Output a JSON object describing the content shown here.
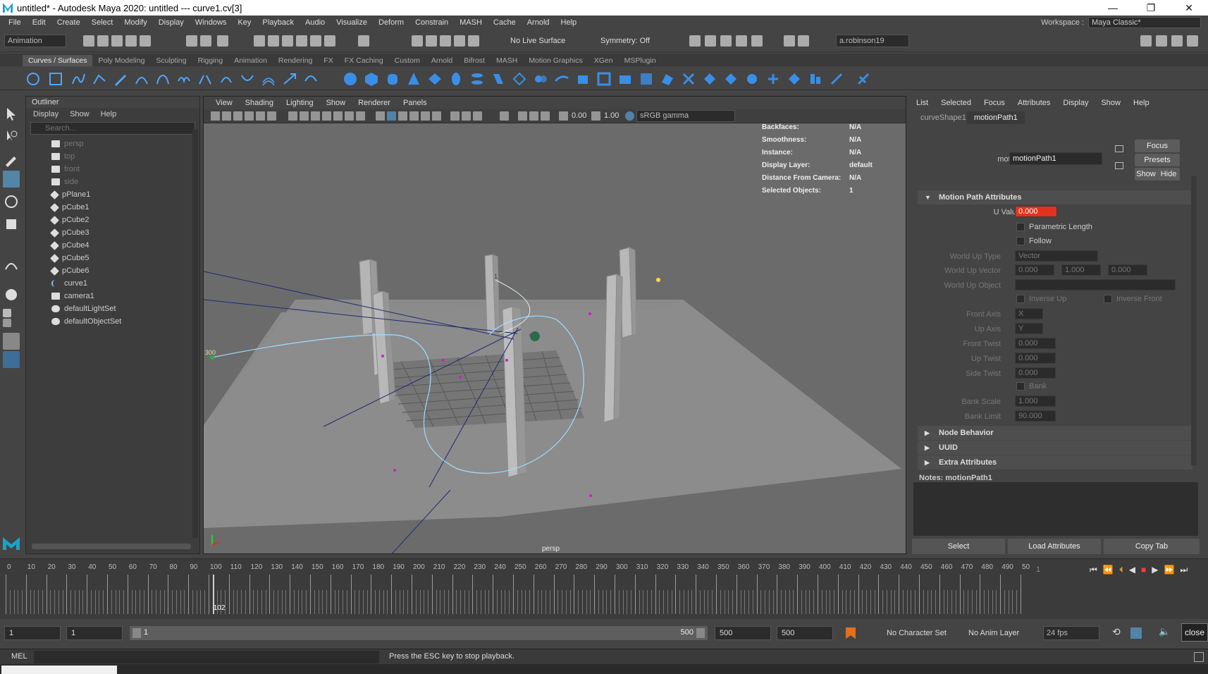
{
  "window": {
    "title": "untitled* - Autodesk Maya 2020: untitled   ---   curve1.cv[3]",
    "min": "—",
    "max": "❐",
    "close": "✕"
  },
  "menus": [
    "File",
    "Edit",
    "Create",
    "Select",
    "Modify",
    "Display",
    "Windows",
    "Key",
    "Playback",
    "Audio",
    "Visualize",
    "Deform",
    "Constrain",
    "MASH",
    "Cache",
    "Arnold",
    "Help"
  ],
  "workspace": {
    "label": "Workspace :",
    "value": "Maya Classic*"
  },
  "statusline": {
    "menuset": "Animation",
    "live_surface": "No Live Surface",
    "symmetry": "Symmetry: Off",
    "user": "a.robinson19"
  },
  "shelf_tabs": [
    "Curves / Surfaces",
    "Poly Modeling",
    "Sculpting",
    "Rigging",
    "Animation",
    "Rendering",
    "FX",
    "FX Caching",
    "Custom",
    "Arnold",
    "Bifrost",
    "MASH",
    "Motion Graphics",
    "XGen",
    "MSPlugin"
  ],
  "outliner": {
    "title": "Outliner",
    "menu": [
      "Display",
      "Show",
      "Help"
    ],
    "search_placeholder": "Search...",
    "items": [
      "persp",
      "top",
      "front",
      "side",
      "pPlane1",
      "pCube1",
      "pCube2",
      "pCube3",
      "pCube4",
      "pCube5",
      "pCube6",
      "curve1",
      "camera1",
      "defaultLightSet",
      "defaultObjectSet"
    ]
  },
  "viewport": {
    "menu": [
      "View",
      "Shading",
      "Lighting",
      "Show",
      "Renderer",
      "Panels"
    ],
    "exposure": "0.00",
    "gamma": "1.00",
    "colorspace": "sRGB gamma",
    "camera_label": "persp",
    "frame_marker": "300",
    "hud": [
      {
        "k": "Backfaces:",
        "v": "N/A"
      },
      {
        "k": "Smoothness:",
        "v": "N/A"
      },
      {
        "k": "Instance:",
        "v": "N/A"
      },
      {
        "k": "Display Layer:",
        "v": "default"
      },
      {
        "k": "Distance From Camera:",
        "v": "N/A"
      },
      {
        "k": "Selected Objects:",
        "v": "1"
      }
    ]
  },
  "attr": {
    "menu": [
      "List",
      "Selected",
      "Focus",
      "Attributes",
      "Display",
      "Show",
      "Help"
    ],
    "tabs": [
      "curveShape1",
      "motionPath1"
    ],
    "node_label": "motionPath:",
    "node_value": "motionPath1",
    "focus": "Focus",
    "presets": "Presets",
    "show": "Show",
    "hide": "Hide",
    "section": "Motion Path Attributes",
    "u_value_label": "U Value",
    "u_value": "0.000",
    "parametric_length": "Parametric Length",
    "follow": "Follow",
    "world_up_type_label": "World Up Type",
    "world_up_type": "Vector",
    "world_up_vector_label": "World Up Vector",
    "wuv": [
      "0.000",
      "1.000",
      "0.000"
    ],
    "world_up_object_label": "World Up Object",
    "inverse_up": "Inverse Up",
    "inverse_front": "Inverse Front",
    "front_axis_label": "Front Axis",
    "front_axis": "X",
    "up_axis_label": "Up Axis",
    "up_axis": "Y",
    "front_twist_label": "Front Twist",
    "front_twist": "0.000",
    "up_twist_label": "Up Twist",
    "up_twist": "0.000",
    "side_twist_label": "Side Twist",
    "side_twist": "0.000",
    "bank": "Bank",
    "bank_scale_label": "Bank Scale",
    "bank_scale": "1.000",
    "bank_limit_label": "Bank Limit",
    "bank_limit": "90.000",
    "collapsed": [
      "Node Behavior",
      "UUID",
      "Extra Attributes"
    ],
    "notes": "Notes:  motionPath1",
    "select": "Select",
    "load": "Load Attributes",
    "copy": "Copy Tab"
  },
  "timeline": {
    "ticks": [
      "0",
      "10",
      "20",
      "30",
      "40",
      "50",
      "60",
      "70",
      "80",
      "90",
      "100",
      "110",
      "120",
      "130",
      "140",
      "150",
      "160",
      "170",
      "180",
      "190",
      "200",
      "210",
      "220",
      "230",
      "240",
      "250",
      "260",
      "270",
      "280",
      "290",
      "300",
      "310",
      "320",
      "330",
      "340",
      "350",
      "360",
      "370",
      "380",
      "390",
      "400",
      "410",
      "420",
      "430",
      "440",
      "450",
      "460",
      "470",
      "480",
      "490",
      "50"
    ],
    "current": "102",
    "current_frame_field": "1"
  },
  "range": {
    "start": "1",
    "playstart": "1",
    "slider_start": "1",
    "slider_end": "500",
    "playend": "500",
    "end": "500",
    "char_set": "No Character Set",
    "anim_layer": "No Anim Layer",
    "fps": "24 fps",
    "close_tooltip": "close"
  },
  "cmdline": {
    "label": "MEL",
    "help": "Press the ESC key to stop playback."
  }
}
